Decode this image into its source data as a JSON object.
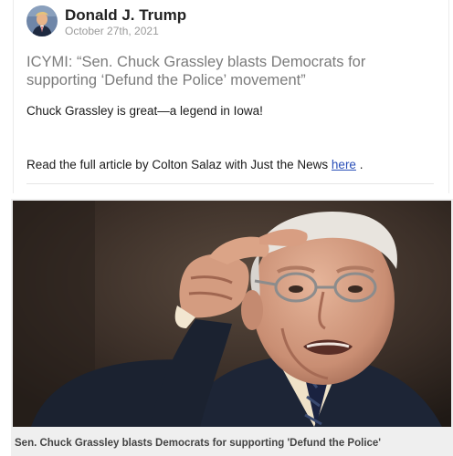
{
  "post": {
    "author": "Donald J. Trump",
    "date": "October 27th, 2021",
    "headline": "ICYMI: “Sen. Chuck Grassley blasts Democrats for supporting ‘Defund the Police’ movement”",
    "body": "Chuck Grassley is great—a legend in Iowa!",
    "read_more_prefix": "Read the full article by Colton Salaz with Just the News ",
    "read_more_link": "here",
    "read_more_suffix": " ."
  },
  "link_card": {
    "image_icon": "photo-senator-gesturing",
    "caption": "Sen. Chuck Grassley blasts Democrats for supporting 'Defund the Police'"
  },
  "colors": {
    "link": "#2a4fb8",
    "headline": "#7b7b7b",
    "caption_bg": "#efefef"
  }
}
